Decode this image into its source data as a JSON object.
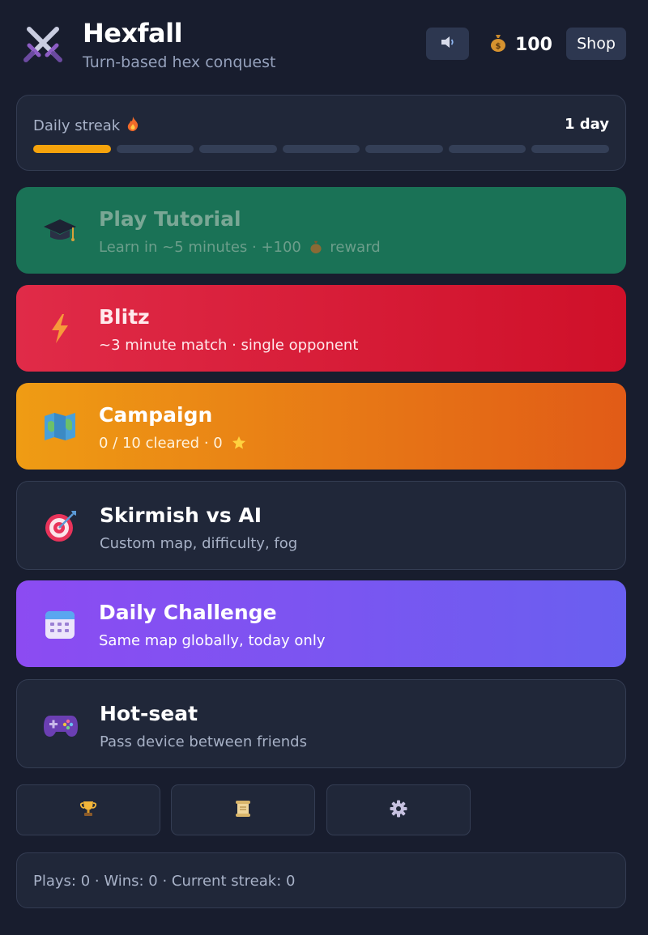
{
  "header": {
    "title": "Hexfall",
    "subtitle": "Turn-based hex conquest",
    "logo_icon": "crossed-swords-icon",
    "sound_icon": "speaker-icon",
    "coin_icon": "money-bag-icon",
    "coins": "100",
    "shop_label": "Shop"
  },
  "streak": {
    "label": "Daily streak",
    "icon": "fire-icon",
    "value": "1 day",
    "days_filled": 1,
    "days_total": 7,
    "fill_color": "#f5a30c"
  },
  "modes": [
    {
      "title": "Play Tutorial",
      "subtitle": "Learn in ~5 minutes · +100",
      "subtitle_suffix": "reward",
      "icon": "graduation-cap-icon",
      "color": "#1a7256"
    },
    {
      "title": "Blitz",
      "subtitle": "~3 minute match · single opponent",
      "icon": "lightning-icon",
      "color": "#d91a35"
    },
    {
      "title": "Campaign",
      "subtitle": "0 / 10 cleared · 0",
      "icon": "map-icon",
      "color": "#ea7c15"
    },
    {
      "title": "Skirmish vs AI",
      "subtitle": "Custom map, difficulty, fog",
      "icon": "target-icon",
      "color": "#202739"
    },
    {
      "title": "Daily Challenge",
      "subtitle": "Same map globally, today only",
      "icon": "calendar-icon",
      "color": "#7b55f1"
    },
    {
      "title": "Hot-seat",
      "subtitle": "Pass device between friends",
      "icon": "gamepad-icon",
      "color": "#202739"
    }
  ],
  "utility": [
    {
      "icon": "trophy-icon"
    },
    {
      "icon": "scroll-icon"
    },
    {
      "icon": "gear-icon"
    }
  ],
  "stats": {
    "text": "Plays: 0 · Wins: 0 · Current streak: 0"
  }
}
